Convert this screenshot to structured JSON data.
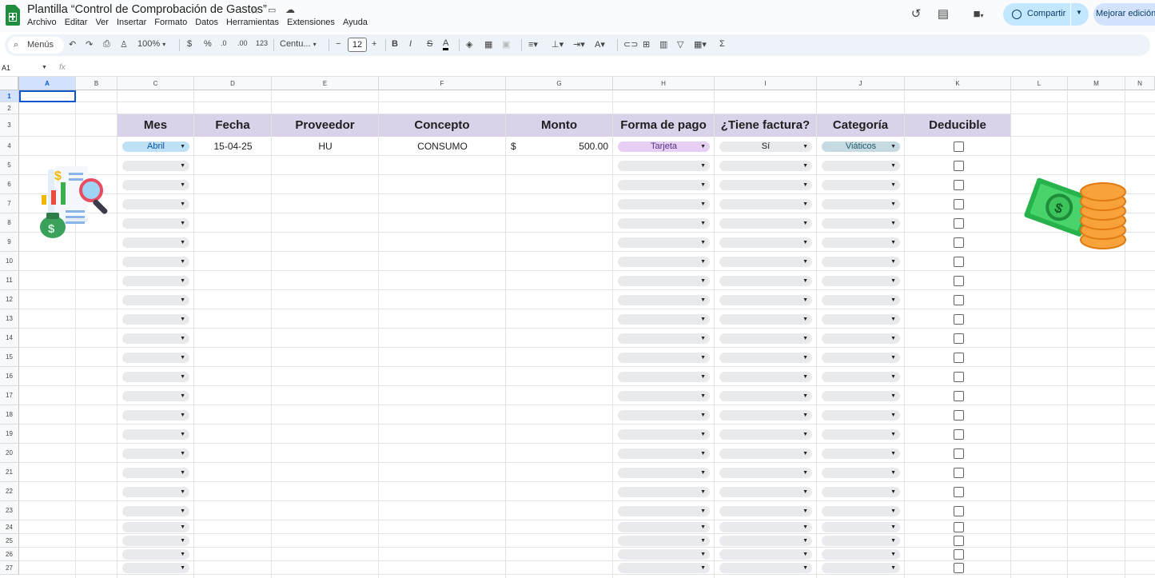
{
  "app": {
    "doc_title": "Plantilla “Control de Comprobación de Gastos”",
    "menu": [
      "Archivo",
      "Editar",
      "Ver",
      "Insertar",
      "Formato",
      "Datos",
      "Herramientas",
      "Extensiones",
      "Ayuda"
    ],
    "share_label": "Compartir",
    "upgrade_label": "Mejorar edición"
  },
  "toolbar": {
    "search_label": "Menús",
    "zoom": "100%",
    "currency": "$",
    "percent": "%",
    "dec_less": ".0",
    "dec_more": ".00",
    "number_format": "123",
    "font": "Centu...",
    "font_size": "12",
    "sum": "Σ"
  },
  "formula_bar": {
    "name_box": "A1",
    "fx": "fx"
  },
  "grid": {
    "columns": [
      "A",
      "B",
      "C",
      "D",
      "E",
      "F",
      "G",
      "H",
      "I",
      "J",
      "K",
      "L",
      "M",
      "N"
    ],
    "selected_column": "A",
    "rows": [
      "1",
      "2",
      "3",
      "4",
      "5",
      "6",
      "7",
      "8",
      "9",
      "10",
      "11",
      "12",
      "13",
      "14",
      "15",
      "16",
      "17",
      "18",
      "19",
      "20",
      "21",
      "22",
      "23",
      "24",
      "25",
      "26",
      "27"
    ],
    "selected_row": "1"
  },
  "table": {
    "headers": [
      "Mes",
      "Fecha",
      "Proveedor",
      "Concepto",
      "Monto",
      "Forma de pago",
      "¿Tiene factura?",
      "Categoría",
      "Deducible"
    ],
    "row": {
      "mes": "Abril",
      "fecha": "15-04-25",
      "proveedor": "HU",
      "concepto": "CONSUMO",
      "monto_symbol": "$",
      "monto": "500.00",
      "forma_pago": "Tarjeta",
      "factura": "Sí",
      "categoria": "Viáticos",
      "deducible": false
    }
  },
  "colors": {
    "header_fill": "#d9d2e9",
    "chip_mes": "#bfe1f6",
    "chip_tarjeta": "#e6cff2",
    "chip_viaticos": "#c6dbe1",
    "chip_empty": "#e8eaed",
    "selection": "#0b57d0"
  }
}
